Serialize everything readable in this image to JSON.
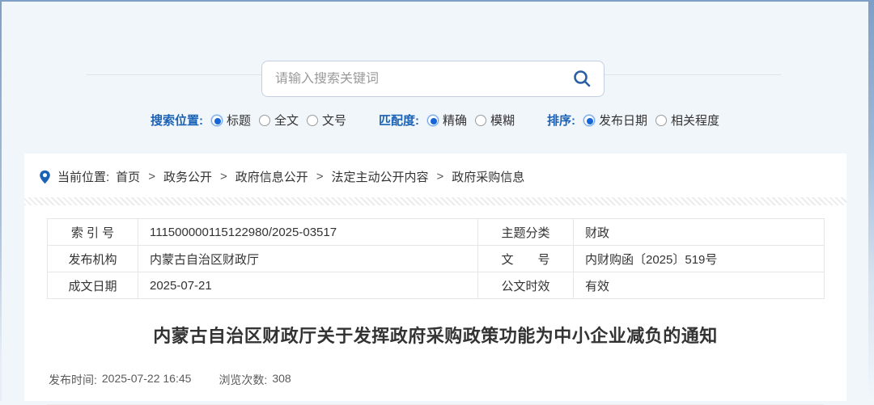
{
  "search": {
    "placeholder": "请输入搜索关键词"
  },
  "filters": {
    "position": {
      "label": "搜索位置:",
      "options": [
        {
          "label": "标题",
          "checked": true
        },
        {
          "label": "全文",
          "checked": false
        },
        {
          "label": "文号",
          "checked": false
        }
      ]
    },
    "match": {
      "label": "匹配度:",
      "options": [
        {
          "label": "精确",
          "checked": true
        },
        {
          "label": "模糊",
          "checked": false
        }
      ]
    },
    "sort": {
      "label": "排序:",
      "options": [
        {
          "label": "发布日期",
          "checked": true
        },
        {
          "label": "相关程度",
          "checked": false
        }
      ]
    }
  },
  "breadcrumb": {
    "label": "当前位置:",
    "separator": ">",
    "items": [
      "首页",
      "政务公开",
      "政府信息公开",
      "法定主动公开内容",
      "政府采购信息"
    ]
  },
  "doc_info": {
    "rows": [
      {
        "l1": "索 引 号",
        "v1": "111500000115122980/2025-03517",
        "l2": "主题分类",
        "v2": "财政"
      },
      {
        "l1": "发布机构",
        "v1": "内蒙古自治区财政厅",
        "l2": "文　　号",
        "v2": "内财购函〔2025〕519号"
      },
      {
        "l1": "成文日期",
        "v1": "2025-07-21",
        "l2": "公文时效",
        "v2": "有效"
      }
    ]
  },
  "document": {
    "title": "内蒙古自治区财政厅关于发挥政府采购政策功能为中小企业减负的通知"
  },
  "meta": {
    "publish_label": "发布时间:",
    "publish_value": "2025-07-22 16:45",
    "views_label": "浏览次数:",
    "views_value": "308"
  },
  "colors": {
    "accent_blue": "#1b62b5",
    "frame_blue": "#7e9fc6",
    "page_bg": "#f1f6fb"
  }
}
